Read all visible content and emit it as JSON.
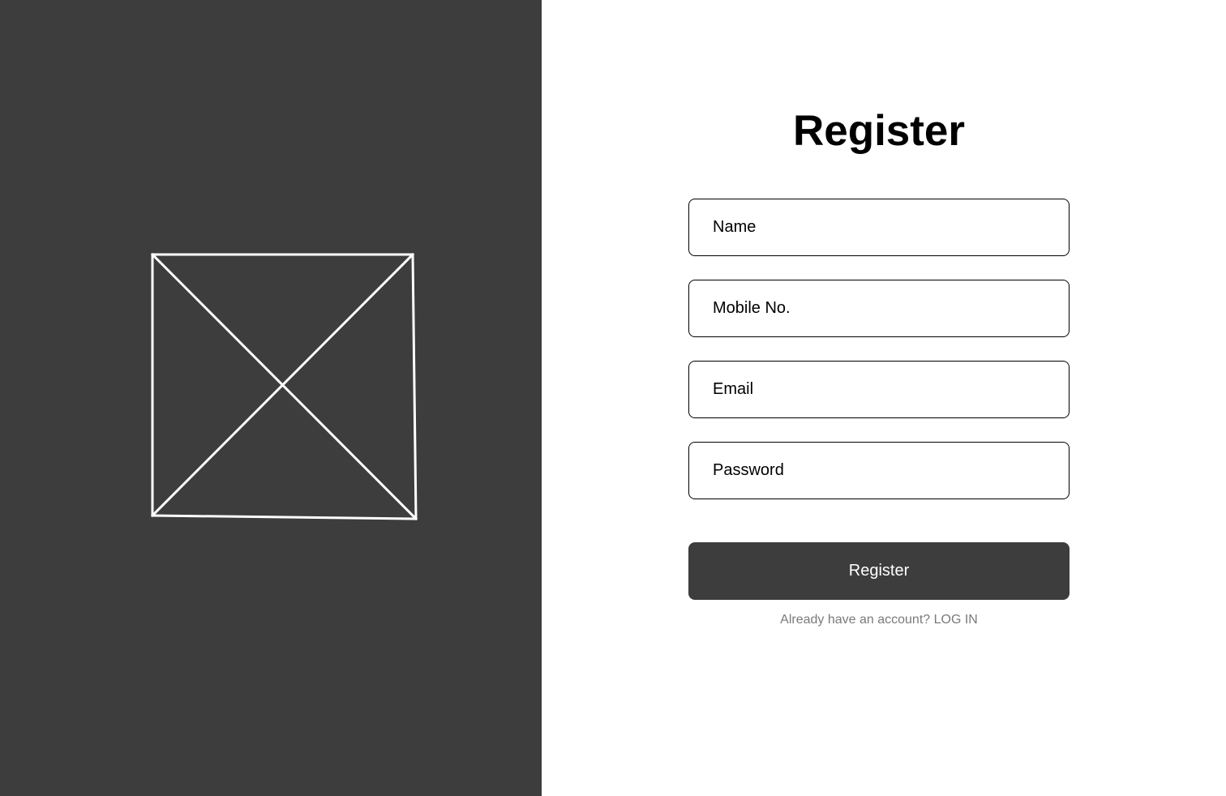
{
  "colors": {
    "panel_dark": "#3d3d3d",
    "background": "#ffffff",
    "text_primary": "#000000",
    "text_muted": "#7a7a7a",
    "button_text": "#ffffff"
  },
  "hero": {
    "image_icon": "image-placeholder-icon"
  },
  "form": {
    "title": "Register",
    "fields": {
      "name": {
        "placeholder": "Name",
        "value": ""
      },
      "mobile": {
        "placeholder": "Mobile No.",
        "value": ""
      },
      "email": {
        "placeholder": "Email",
        "value": ""
      },
      "password": {
        "placeholder": "Password",
        "value": ""
      }
    },
    "submit_label": "Register",
    "login_prompt": "Already have an account?",
    "login_link": "LOG IN"
  }
}
